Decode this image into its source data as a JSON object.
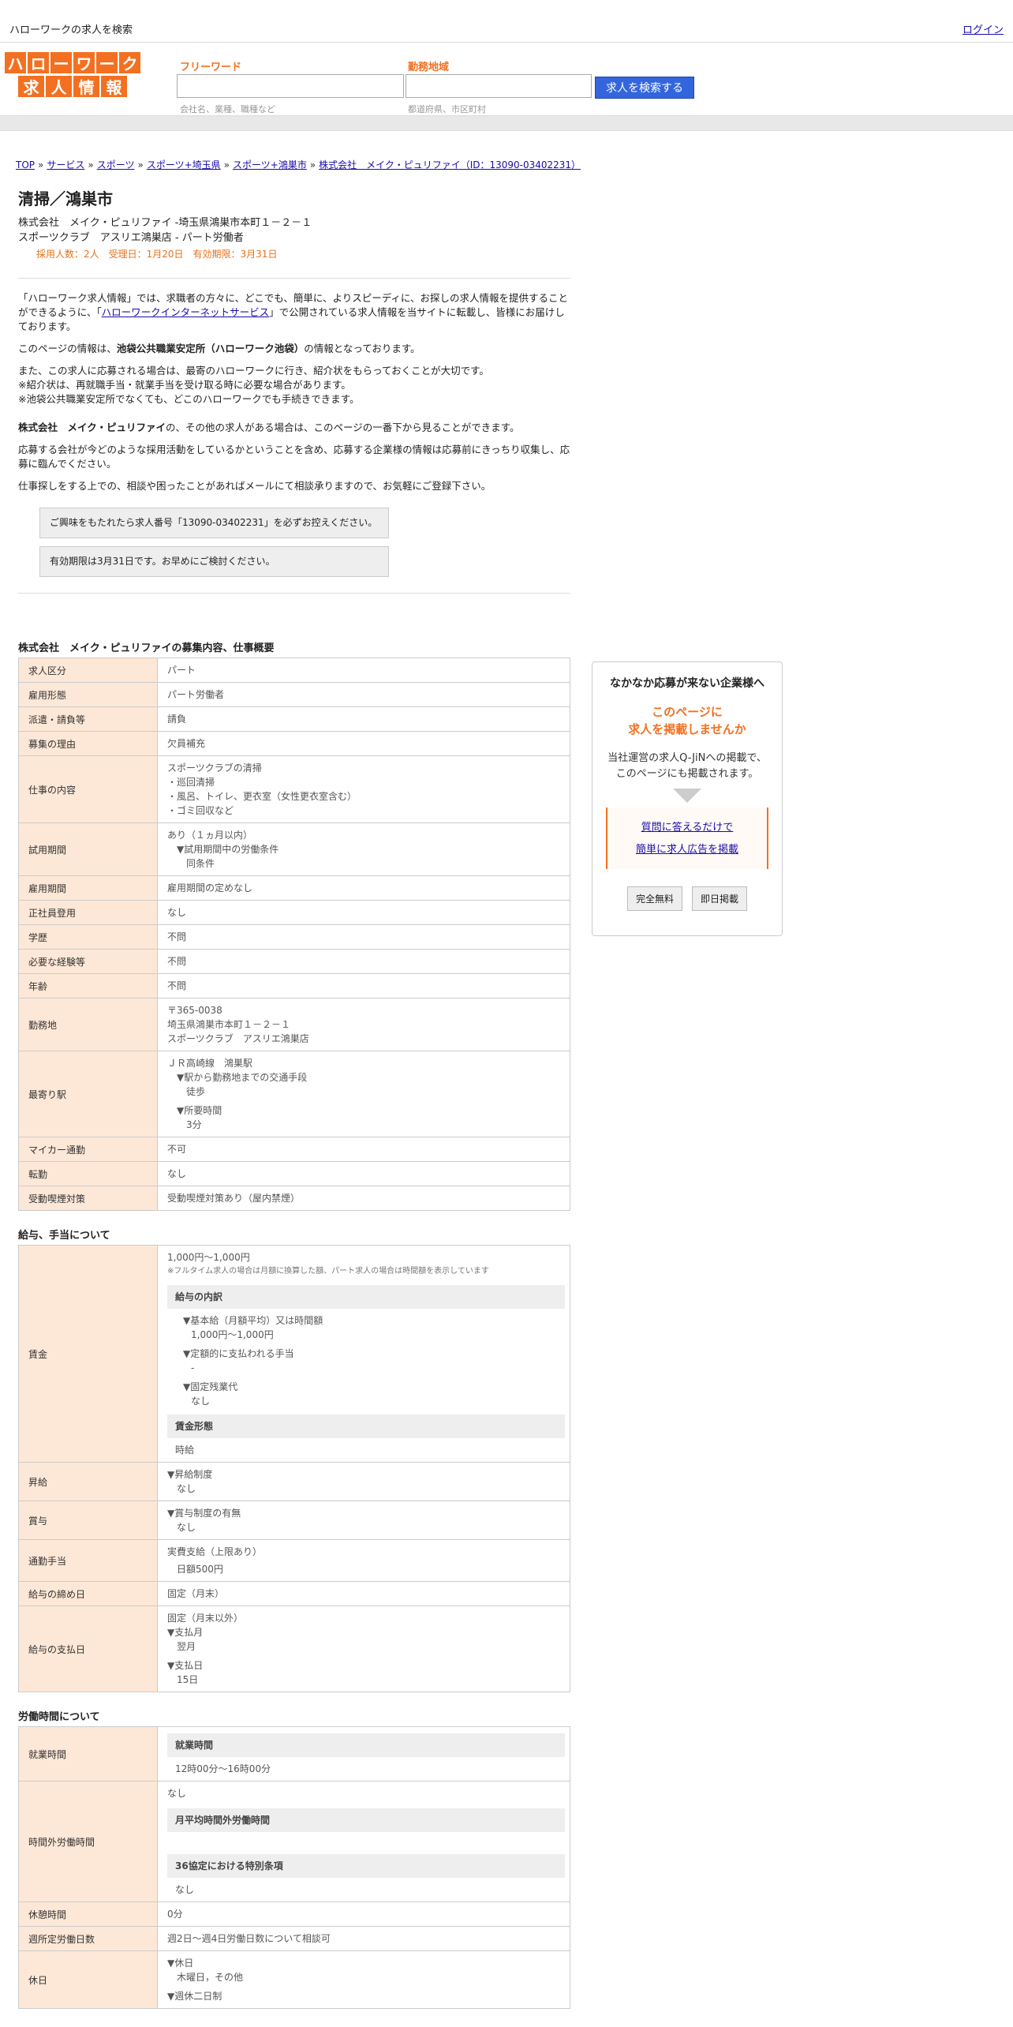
{
  "topbar": {
    "title": "ハローワークの求人を検索",
    "login": "ログイン"
  },
  "logo": {
    "row1": [
      "ハ",
      "ロ",
      "ー",
      "ワ",
      "ー",
      "ク"
    ],
    "row2": [
      "求",
      "人",
      "情",
      "報"
    ]
  },
  "search": {
    "free_word_label": "フリーワード",
    "free_word_hint": "会社名、業種、職種など",
    "area_label": "勤務地域",
    "area_hint": "都道府県、市区町村",
    "button": "求人を検索する"
  },
  "breadcrumb": {
    "items": [
      "TOP",
      "サービス",
      "スポーツ",
      "スポーツ+埼玉県",
      "スポーツ+鴻巣市",
      "株式会社　メイク・ピュリファイ（ID：13090-03402231）"
    ],
    "sep": "»"
  },
  "job": {
    "title": "清掃／鴻巣市",
    "company_line": "株式会社　メイク・ピュリファイ -埼玉県鴻巣市本町１－２－１",
    "place_line": "スポーツクラブ　アスリエ鴻巣店 - パート労働者",
    "meta": "採用人数：2人　受理日：1月20日　有効期限：3月31日"
  },
  "intro": {
    "p1_a": "「ハローワーク求人情報」では、求職者の方々に、どこでも、簡単に、よりスピーディに、お探しの求人情報を提供することができるように、「",
    "p1_link": "ハローワークインターネットサービス",
    "p1_b": "」で公開されている求人情報を当サイトに転載し、皆様にお届けしております。",
    "p2_a": "このページの情報は、",
    "p2_b": "池袋公共職業安定所（ハローワーク池袋）",
    "p2_c": "の情報となっております。",
    "p3_1": "また、この求人に応募される場合は、最寄のハローワークに行き、紹介状をもらっておくことが大切です。",
    "p3_2": "※紹介状は、再就職手当・就業手当を受け取る時に必要な場合があります。",
    "p3_3": "※池袋公共職業安定所でなくても、どこのハローワークでも手続きできます。",
    "p4_a": "株式会社　メイク・ピュリファイ",
    "p4_b": "の、その他の求人がある場合は、このページの一番下から見ることができます。",
    "p5": "応募する会社が今どのような採用活動をしているかということを含め、応募する企業様の情報は応募前にきっちり収集し、応募に臨んでください。",
    "p6": "仕事探しをする上での、相談や困ったことがあればメールにて相談承りますので、お気軽にご登録下さい。",
    "box1": "ご興味をもたれたら求人番号「13090-03402231」を必ずお控えください。",
    "box2": "有効期限は3月31日です。お早めにご検討ください。"
  },
  "overview": {
    "title": "株式会社　メイク・ピュリファイの募集内容、仕事概要",
    "rows": [
      {
        "h": "求人区分",
        "v": "パート"
      },
      {
        "h": "雇用形態",
        "v": "パート労働者"
      },
      {
        "h": "派遣・請負等",
        "v": "請負"
      },
      {
        "h": "募集の理由",
        "v": "欠員補充"
      },
      {
        "h": "仕事の内容",
        "v1": "スポーツクラブの清掃",
        "v2": "・巡回清掃",
        "v3": "・風呂、トイレ、更衣室（女性更衣室含む）",
        "v4": "・ゴミ回収など"
      },
      {
        "h": "試用期間",
        "v1": "あり（１ヵ月以内）",
        "v2": "▼試用期間中の労働条件",
        "v3": "同条件"
      },
      {
        "h": "雇用期間",
        "v": "雇用期間の定めなし"
      },
      {
        "h": "正社員登用",
        "v": "なし"
      },
      {
        "h": "学歴",
        "v": "不問"
      },
      {
        "h": "必要な経験等",
        "v": "不問"
      },
      {
        "h": "年齢",
        "v": "不問"
      },
      {
        "h": "勤務地",
        "v1": "〒365-0038",
        "v2": "埼玉県鴻巣市本町１－２－１",
        "v3": "スポーツクラブ　アスリエ鴻巣店"
      },
      {
        "h": "最寄り駅",
        "v1": "ＪＲ高崎線　鴻巣駅",
        "v2": "▼駅から勤務地までの交通手段",
        "v3": "徒歩",
        "v4": "▼所要時間",
        "v5": "3分"
      },
      {
        "h": "マイカー通勤",
        "v": "不可"
      },
      {
        "h": "転勤",
        "v": "なし"
      },
      {
        "h": "受動喫煙対策",
        "v": "受動喫煙対策あり（屋内禁煙）"
      }
    ]
  },
  "salary": {
    "title": "給与、手当について",
    "wage_h": "賃金",
    "wage_v": "1,000円〜1,000円",
    "wage_note": "※フルタイム求人の場合は月額に換算した額、パート求人の場合は時間額を表示しています",
    "breakdown_title": "給与の内訳",
    "b1": "▼基本給（月額平均）又は時間額",
    "b1v": "1,000円〜1,000円",
    "b2": "▼定額的に支払われる手当",
    "b2v": "-",
    "b3": "▼固定残業代",
    "b3v": "なし",
    "form_title": "賃金形態",
    "form_v": "時給",
    "raise_h": "昇給",
    "raise_1": "▼昇給制度",
    "raise_2": "なし",
    "bonus_h": "賞与",
    "bonus_1": "▼賞与制度の有無",
    "bonus_2": "なし",
    "commute_h": "通勤手当",
    "commute_1": "実費支給（上限あり）",
    "commute_2": "日額500円",
    "close_h": "給与の締め日",
    "close_v": "固定（月末）",
    "pay_h": "給与の支払日",
    "pay_1": "固定（月末以外）",
    "pay_2": "▼支払月",
    "pay_3": "翌月",
    "pay_4": "▼支払日",
    "pay_5": "15日"
  },
  "hours": {
    "title": "労働時間について",
    "work_h": "就業時間",
    "work_sub": "就業時間",
    "work_v": "12時00分〜16時00分",
    "ot_h": "時間外労働時間",
    "ot_v": "なし",
    "ot_sub1": "月平均時間外労働時間",
    "ot_sub2": "36協定における特別条項",
    "ot_v2": "なし",
    "rest_h": "休憩時間",
    "rest_v": "0分",
    "days_h": "週所定労働日数",
    "days_v": "週2日〜週4日労働日数について相談可",
    "holiday_h": "休日",
    "hol_1": "▼休日",
    "hol_2": "木曜日，その他",
    "hol_3": "▼週休二日制"
  },
  "ad": {
    "heading": "なかなか応募が来ない企業様へ",
    "orange1": "このページに",
    "orange2": "求人を掲載しませんか",
    "text1": "当社運営の求人Q-JiNへの掲載で、",
    "text2": "このページにも掲載されます。",
    "link1": "質問に答えるだけで",
    "link2": "簡単に求人広告を掲載",
    "btn1": "完全無料",
    "btn2": "即日掲載"
  }
}
